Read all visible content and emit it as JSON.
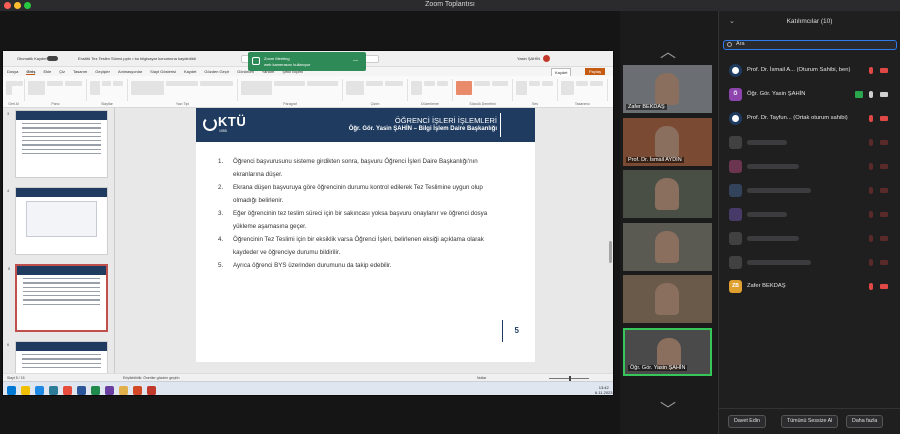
{
  "window": {
    "title": "Zoom Toplantısı"
  },
  "colors": {
    "accent": "#2f7bea",
    "speaking": "#35c759",
    "slide_band": "#1f3c60",
    "notif": "#2e8b57"
  },
  "ppt": {
    "autosave": "Otomatik Kaydet",
    "doc_title": "Enstitü Tez Teslim Süreci.pptx • bu bilgisayar konumuna kaydedildi",
    "search_placeholder": "Ara",
    "user": "Yasin ŞAHİN",
    "tabs": [
      "Dosya",
      "Giriş",
      "Ekle",
      "Çiz",
      "Tasarım",
      "Geçişler",
      "Animasyonlar",
      "Slayt Gösterisi",
      "Kaydet",
      "Gözden Geçir",
      "Görünüm",
      "Yardım",
      "Şekil Biçimi"
    ],
    "save_label": "Kaydet",
    "share_label": "Paylaş",
    "ribbon_groups": [
      "Geri Al",
      "Pano",
      "Slaytlar",
      "Yazı Tipi",
      "Paragraf",
      "Çizim",
      "Düzenleme",
      "Sözcük Denetimi",
      "Ses",
      "Tasarımcı"
    ],
    "thumb_numbers": [
      "3",
      "4",
      "5",
      "6"
    ],
    "status_left": "Slayt 5 / 15",
    "status_mid": "Erişilebilirlik: Öneriler gözden geçirin",
    "status_notes": "Notlar",
    "clock_time": "13:42",
    "clock_date": "6.11.2023"
  },
  "slide": {
    "logo_name": "KTÜ",
    "logo_sub": "1955",
    "header_line1": "ÖĞRENCİ İŞLERİ İŞLEMLERİ",
    "header_line2": "Öğr. Gör. Yasin ŞAHİN – Bilgi İşlem Daire Başkanlığı",
    "items": [
      {
        "n": "1.",
        "text": "Öğrenci başvurusunu sisteme girdikten sonra, başvuru Öğrenci İşleri Daire Başkanlığı'nın ekranlarına düşer."
      },
      {
        "n": "2.",
        "text": "Ekrana düşen başvuruya göre öğrencinin durumu kontrol edilerek Tez Teslimine uygun olup olmadığı belirlenir."
      },
      {
        "n": "3.",
        "text": "Eğer öğrencinin tez teslim süreci için bir sakıncası yoksa başvuru onaylanır ve öğrenci dosya yükleme aşamasına geçer."
      },
      {
        "n": "4.",
        "text": "Öğrencinin Tez Teslimi için bir eksiklik varsa Öğrenci İşleri, belirlenen eksiği açıklama olarak kaydeder ve öğrenciye durumu bildirilir."
      },
      {
        "n": "5.",
        "text": "Ayrıca öğrenci BYS üzerinden durumunu da takip edebilir."
      }
    ],
    "page_number": "5"
  },
  "notification": {
    "line1": "Zoom Meeting",
    "line2": "web kamerasını kullanıyor"
  },
  "videos": [
    {
      "name": "Zafer BEKDAŞ",
      "active": false,
      "tone": "#6b6f73"
    },
    {
      "name": "Prof. Dr. İsmail AYDIN",
      "active": false,
      "tone": "#7a4a32"
    },
    {
      "name": "",
      "active": false,
      "tone": "#4a4f45"
    },
    {
      "name": "",
      "active": false,
      "tone": "#5a5a52"
    },
    {
      "name": "",
      "active": false,
      "tone": "#6a5a4a"
    },
    {
      "name": "Öğr. Gör. Yasin ŞAHİN",
      "active": true,
      "tone": "#4a4a4a"
    }
  ],
  "panel": {
    "title": "Katılımcılar (10)",
    "search_value": "Ara",
    "participants": [
      {
        "name": "Prof. Dr. İsmail A... (Oturum Sahibi, ben)",
        "initials": "",
        "av_color": "#2c3e50",
        "blurred": false
      },
      {
        "name": "Öğr. Gör. Yasin ŞAHİN",
        "initials": "Ö",
        "av_color": "#8e44ad",
        "blurred": false
      },
      {
        "name": "Prof. Dr. Tayfun... (Ortak oturum sahibi)",
        "initials": "",
        "av_color": "#2c3e50",
        "blurred": false
      },
      {
        "name": "",
        "initials": "",
        "av_color": "#6b6b6b",
        "blurred": true
      },
      {
        "name": "",
        "initials": "",
        "av_color": "#c94f8a",
        "blurred": true
      },
      {
        "name": "",
        "initials": "",
        "av_color": "#4a6fa5",
        "blurred": true
      },
      {
        "name": "",
        "initials": "",
        "av_color": "#7a5cc2",
        "blurred": true
      },
      {
        "name": "",
        "initials": "",
        "av_color": "#6b6b6b",
        "blurred": true
      },
      {
        "name": "",
        "initials": "",
        "av_color": "#6b6b6b",
        "blurred": true
      },
      {
        "name": "Zafer BEKDAŞ",
        "initials": "ZB",
        "av_color": "#e0a030",
        "blurred": false
      }
    ],
    "invite_label": "Davet Edin",
    "mute_all_label": "Tümünü Sessize Al",
    "more_label": "Daha fazla"
  }
}
